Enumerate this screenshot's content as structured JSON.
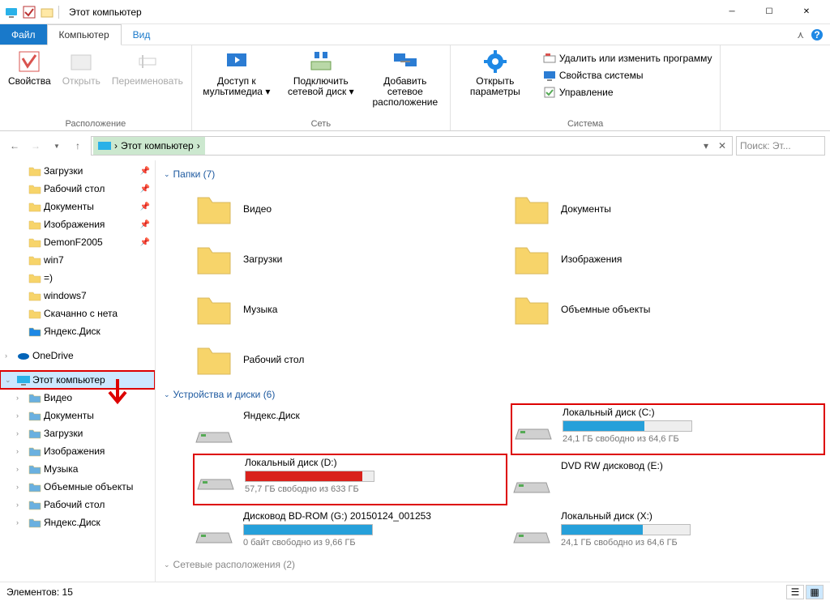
{
  "window": {
    "title": "Этот компьютер"
  },
  "menu": {
    "file": "Файл",
    "computer": "Компьютер",
    "view": "Вид"
  },
  "ribbon": {
    "location": {
      "label": "Расположение",
      "properties": "Свойства",
      "open": "Открыть",
      "rename": "Переименовать"
    },
    "network": {
      "label": "Сеть",
      "media": "Доступ к мультимедиа",
      "map_drive": "Подключить сетевой диск",
      "add_location": "Добавить сетевое расположение"
    },
    "system": {
      "label": "Система",
      "open_settings": "Открыть параметры",
      "uninstall": "Удалить или изменить программу",
      "sys_props": "Свойства системы",
      "manage": "Управление"
    }
  },
  "address": {
    "crumb": "Этот компьютер",
    "search_placeholder": "Поиск: Эт..."
  },
  "sidebar": {
    "items": [
      {
        "label": "Загрузки",
        "pinned": true
      },
      {
        "label": "Рабочий стол",
        "pinned": true
      },
      {
        "label": "Документы",
        "pinned": true
      },
      {
        "label": "Изображения",
        "pinned": true
      },
      {
        "label": "DemonF2005",
        "pinned": true
      },
      {
        "label": "win7"
      },
      {
        "label": "=)"
      },
      {
        "label": "windows7"
      },
      {
        "label": "Скачанно с нета"
      },
      {
        "label": "Яндекс.Диск"
      }
    ],
    "onedrive": "OneDrive",
    "this_pc": "Этот компьютер",
    "pc_children": [
      "Видео",
      "Документы",
      "Загрузки",
      "Изображения",
      "Музыка",
      "Объемные объекты",
      "Рабочий стол",
      "Яндекс.Диск"
    ]
  },
  "content": {
    "folders_header": "Папки (7)",
    "drives_header": "Устройства и диски (6)",
    "network_header": "Сетевые расположения (2)",
    "folders": [
      "Видео",
      "Документы",
      "Загрузки",
      "Изображения",
      "Музыка",
      "Объемные объекты",
      "Рабочий стол"
    ],
    "drives": [
      {
        "name": "Яндекс.Диск",
        "sub": "",
        "bar": null
      },
      {
        "name": "Локальный диск (C:)",
        "sub": "24,1 ГБ свободно из 64,6 ГБ",
        "bar": {
          "pct": 63,
          "color": "#26a0da"
        },
        "highlight": true
      },
      {
        "name": "Локальный диск (D:)",
        "sub": "57,7 ГБ свободно из 633 ГБ",
        "bar": {
          "pct": 91,
          "color": "#d9221c"
        },
        "highlight": true
      },
      {
        "name": "DVD RW дисковод (E:)",
        "sub": "",
        "bar": null
      },
      {
        "name": "Дисковод BD-ROM (G:) 20150124_001253",
        "sub": "0 байт свободно из 9,66 ГБ",
        "bar": {
          "pct": 100,
          "color": "#26a0da"
        }
      },
      {
        "name": "Локальный диск (X:)",
        "sub": "24,1 ГБ свободно из 64,6 ГБ",
        "bar": {
          "pct": 63,
          "color": "#26a0da"
        }
      }
    ]
  },
  "status": {
    "items": "Элементов: 15"
  }
}
